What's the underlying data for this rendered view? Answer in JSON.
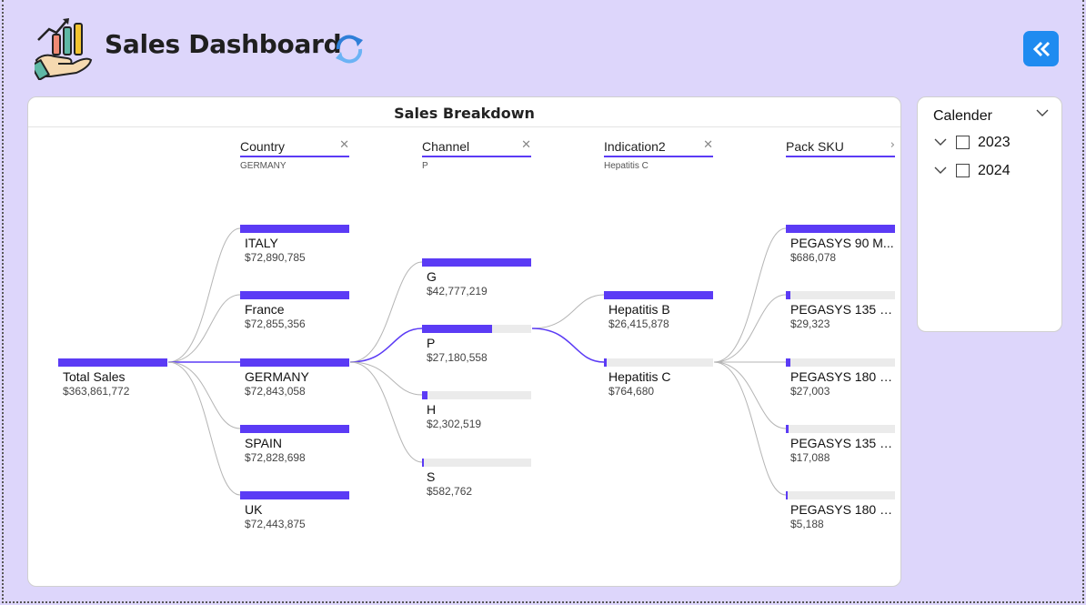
{
  "header": {
    "title": "Sales Dashboard",
    "logo_icon": "sales-chart-hand-icon",
    "refresh_icon": "refresh-icon",
    "collapse_icon": "double-chevron-left-icon",
    "accent": "#5b3bf5",
    "collapse_color": "#1f8bf0"
  },
  "visual": {
    "title": "Sales Breakdown",
    "root": {
      "label": "Total Sales",
      "value": "$363,861,772",
      "fraction": 1.0
    },
    "levels": [
      {
        "name": "Country",
        "selected": "GERMANY",
        "removable": true
      },
      {
        "name": "Channel",
        "selected": "P",
        "removable": true
      },
      {
        "name": "Indication2",
        "selected": "Hepatitis C",
        "removable": true
      },
      {
        "name": "Pack SKU",
        "selected": "",
        "removable": false
      }
    ],
    "country": [
      {
        "label": "ITALY",
        "value": "$72,890,785",
        "fraction": 1.0
      },
      {
        "label": "France",
        "value": "$72,855,356",
        "fraction": 1.0
      },
      {
        "label": "GERMANY",
        "value": "$72,843,058",
        "fraction": 1.0,
        "selected": true
      },
      {
        "label": "SPAIN",
        "value": "$72,828,698",
        "fraction": 1.0
      },
      {
        "label": "UK",
        "value": "$72,443,875",
        "fraction": 1.0
      }
    ],
    "channel": [
      {
        "label": "G",
        "value": "$42,777,219",
        "fraction": 1.0
      },
      {
        "label": "P",
        "value": "$27,180,558",
        "fraction": 0.64,
        "selected": true
      },
      {
        "label": "H",
        "value": "$2,302,519",
        "fraction": 0.054
      },
      {
        "label": "S",
        "value": "$582,762",
        "fraction": 0.014
      }
    ],
    "indication": [
      {
        "label": "Hepatitis B",
        "value": "$26,415,878",
        "fraction": 1.0
      },
      {
        "label": "Hepatitis C",
        "value": "$764,680",
        "fraction": 0.029,
        "selected": true
      }
    ],
    "sku": [
      {
        "label": "PEGASYS 90 M...",
        "value": "$686,078",
        "fraction": 1.0
      },
      {
        "label": "PEGASYS 135 M...",
        "value": "$29,323",
        "fraction": 0.043
      },
      {
        "label": "PEGASYS 180 M...",
        "value": "$27,003",
        "fraction": 0.039
      },
      {
        "label": "PEGASYS 135 M...",
        "value": "$17,088",
        "fraction": 0.025
      },
      {
        "label": "PEGASYS 180 M...",
        "value": "$5,188",
        "fraction": 0.008
      }
    ]
  },
  "slicer": {
    "title": "Calender",
    "items": [
      {
        "label": "2023",
        "checked": false
      },
      {
        "label": "2024",
        "checked": false
      }
    ]
  }
}
